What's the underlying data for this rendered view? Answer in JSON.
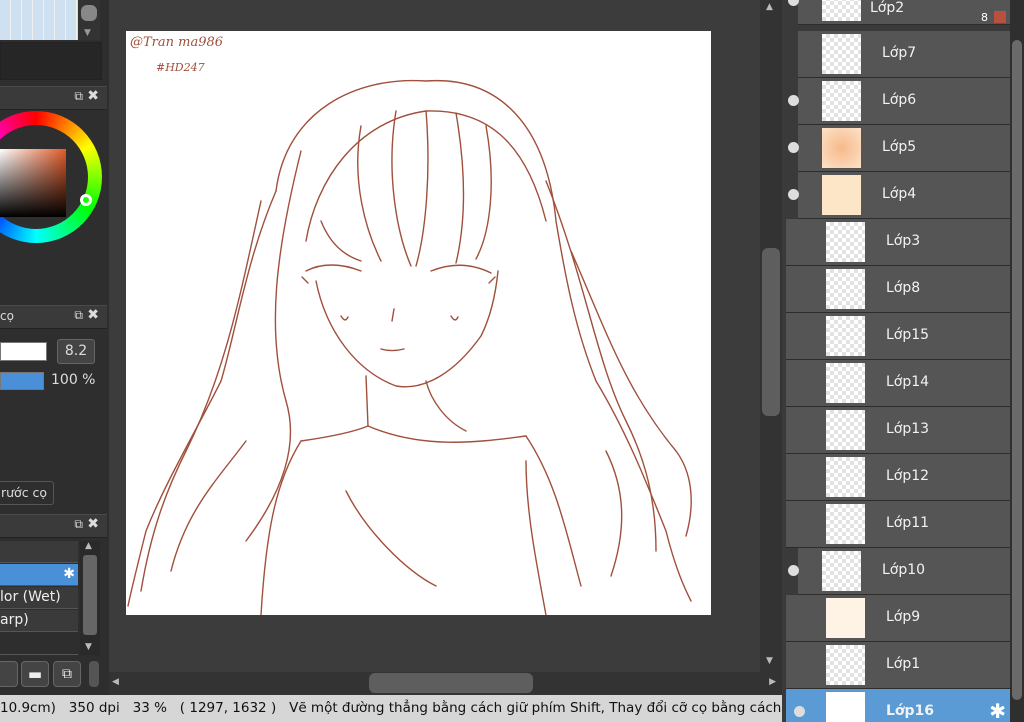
{
  "left_panel": {
    "brush_title": "cọ",
    "brush_size": "8.2",
    "opacity": "100 %",
    "brush_preview_button": "rước cọ",
    "brush_list": [
      "lor (Wet)",
      "arp)"
    ]
  },
  "layers": {
    "top_partial": "Lớp2",
    "top_count": "8",
    "items": [
      {
        "name": "Lớp7"
      },
      {
        "name": "Lớp6"
      },
      {
        "name": "Lớp5"
      },
      {
        "name": "Lớp4"
      },
      {
        "name": "Lớp3"
      },
      {
        "name": "Lớp8"
      },
      {
        "name": "Lớp15"
      },
      {
        "name": "Lớp14"
      },
      {
        "name": "Lớp13"
      },
      {
        "name": "Lớp12"
      },
      {
        "name": "Lớp11"
      },
      {
        "name": "Lớp10"
      },
      {
        "name": "Lớp9"
      },
      {
        "name": "Lớp1"
      },
      {
        "name": "Lớp16"
      }
    ]
  },
  "canvas": {
    "signature": "@Tran ma986",
    "signature_tag": "#HD247"
  },
  "status_bar": {
    "size": "10.9cm)",
    "dpi": "350 dpi",
    "zoom": "33 %",
    "coords": "( 1297, 1632 )",
    "hint": "Vẽ một đường thẳng bằng cách giữ phím Shift, Thay đổi cỡ cọ bằng cách giữ phím Ctrl"
  },
  "colors": {
    "line_art": "#a0503c",
    "selected_layer": "#5b9bd5",
    "selection_blue": "#4a90d9"
  }
}
